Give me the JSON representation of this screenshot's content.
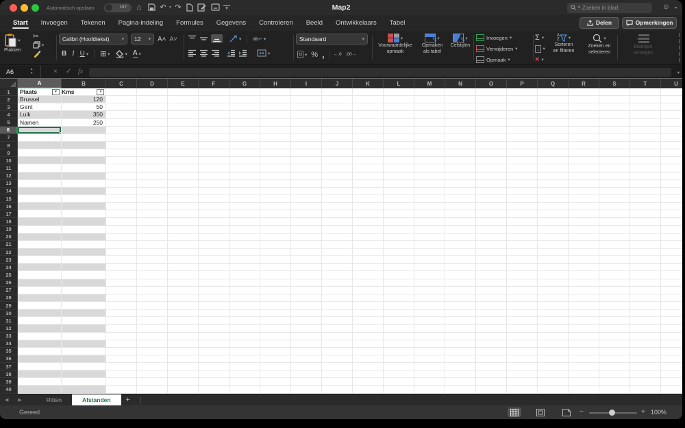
{
  "titlebar": {
    "autosave_label": "Automatisch opslaan",
    "autosave_state": "UIT",
    "title": "Map2",
    "search_placeholder": "Zoeken in blad"
  },
  "ribbon_tabs": [
    {
      "label": "Start",
      "active": true
    },
    {
      "label": "Invoegen",
      "active": false
    },
    {
      "label": "Tekenen",
      "active": false
    },
    {
      "label": "Pagina-indeling",
      "active": false
    },
    {
      "label": "Formules",
      "active": false
    },
    {
      "label": "Gegevens",
      "active": false
    },
    {
      "label": "Controleren",
      "active": false
    },
    {
      "label": "Beeld",
      "active": false
    },
    {
      "label": "Ontwikkelaars",
      "active": false
    },
    {
      "label": "Tabel",
      "active": false
    }
  ],
  "top_actions": {
    "share": "Delen",
    "comments": "Opmerkingen"
  },
  "ribbon": {
    "paste_label": "Plakken",
    "font_name": "Calibri (Hoofdtekst)",
    "font_size": "12",
    "bold": "B",
    "italic": "I",
    "underline": "U",
    "number_format": "Standaard",
    "conditional_line1": "Voorwaardelijke",
    "conditional_line2": "opmaak",
    "format_table_line1": "Opmaken",
    "format_table_line2": "als tabel",
    "cell_styles": "Celstijlen",
    "insert_label": "Invoegen",
    "delete_label": "Verwijderen",
    "format_label": "Opmaak",
    "sort_line1": "Sorteren",
    "sort_line2": "en filteren",
    "find_line1": "Zoeken en",
    "find_line2": "selecteren",
    "sheet_rows_line1": "Bladrijen",
    "sheet_rows_line2": "invoegen"
  },
  "formula_bar": {
    "name_box": "A6",
    "fx": "fx",
    "formula": ""
  },
  "grid": {
    "columns": [
      "A",
      "B",
      "C",
      "D",
      "E",
      "F",
      "G",
      "H",
      "I",
      "J",
      "K",
      "L",
      "M",
      "N",
      "O",
      "P",
      "Q",
      "R",
      "S",
      "T",
      "U"
    ],
    "row_count": 40,
    "selected_cell": "A6",
    "selected_column": "A",
    "selected_row": 6,
    "table": {
      "headers": [
        "Plaats",
        "Kms"
      ],
      "rows": [
        {
          "plaats": "Brussel",
          "kms": "120"
        },
        {
          "plaats": "Gent",
          "kms": "50"
        },
        {
          "plaats": "Luik",
          "kms": "350"
        },
        {
          "plaats": "Namen",
          "kms": "250"
        }
      ]
    }
  },
  "sheet_tabs": {
    "tabs": [
      {
        "name": "Ritten",
        "active": false
      },
      {
        "name": "Afstanden",
        "active": true
      }
    ],
    "add_label": "+"
  },
  "status_bar": {
    "status": "Gereed",
    "zoom_level": "100%"
  },
  "icons": {
    "home": "⌂",
    "undo": "↶",
    "redo": "↷",
    "edit_doc": "✎",
    "chevron": "▾",
    "scissors": "✂",
    "border": "⊞",
    "sigma": "Σ",
    "percent": "%",
    "comma": ",",
    "clear": "×",
    "cancel": "×",
    "check": "✓",
    "wrap_arrow": "↩",
    "arrow_down": "↓",
    "arrow_left": "←",
    "arrow_lr": "↔",
    "smiley": "☺",
    "minus": "−",
    "plus": "+",
    "currency": "¤",
    "sort_up": "↑",
    "prev": "◀",
    "next": "▶",
    "dec_inc": "←.0",
    "dec_dec": ".00→",
    "ab": "ab",
    "filter_sorted": "▾↑",
    "filter": "▾",
    "stepper_up": "▲",
    "stepper_down": "▼"
  },
  "colors": {
    "accent_green": "#217346",
    "selection_green": "#1f7346",
    "band_gray": "#d9d9d9",
    "header_highlight": "#5c5c5c"
  }
}
